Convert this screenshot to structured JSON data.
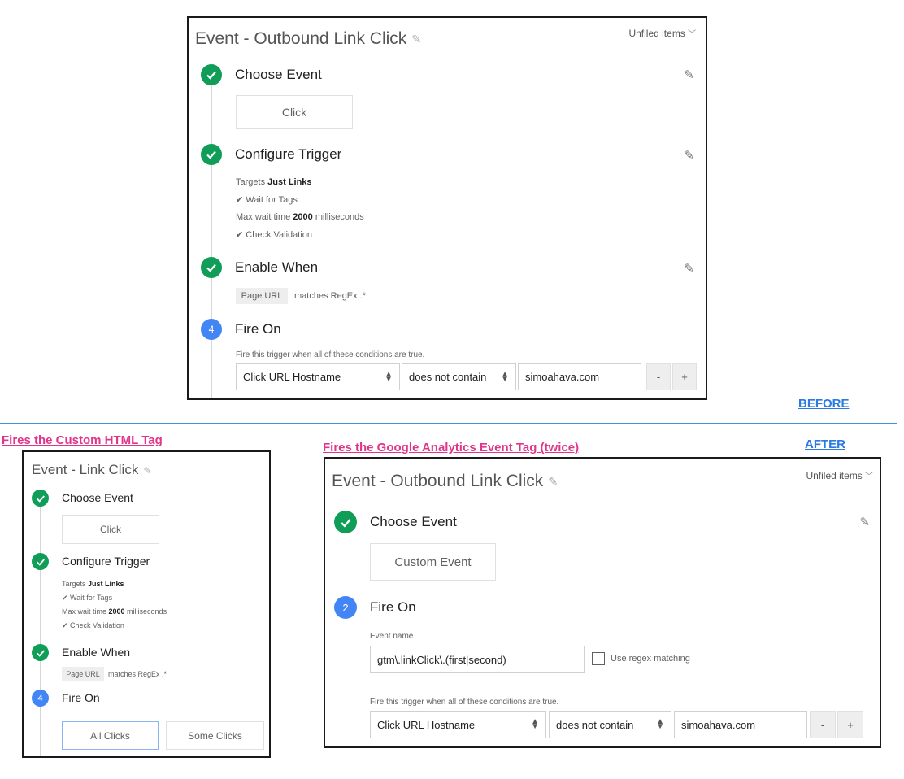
{
  "captions": {
    "before": "BEFORE",
    "after": "AFTER",
    "fires_custom_html": "Fires the  Custom HTML Tag",
    "fires_ga_event": "Fires the Google Analytics Event Tag (twice)"
  },
  "colors": {
    "accent_green": "#0f9d58",
    "accent_blue": "#4285f4",
    "caption_pink": "#e0358a",
    "caption_blue": "#2a7ae2"
  },
  "before": {
    "title": "Event - Outbound Link Click",
    "unfiled": "Unfiled items",
    "step1": {
      "title": "Choose Event",
      "chip": "Click"
    },
    "step2": {
      "title": "Configure Trigger",
      "targets_prefix": "Targets ",
      "targets_value": "Just Links",
      "wait_for_tags": "Wait for Tags",
      "max_wait_prefix": "Max wait time ",
      "max_wait_value": "2000",
      "max_wait_suffix": " milliseconds",
      "check_validation": "Check Validation"
    },
    "step3": {
      "title": "Enable When",
      "pill": "Page URL",
      "condition": "matches RegEx .*"
    },
    "step4": {
      "number": "4",
      "title": "Fire On",
      "hint": "Fire this trigger when all of these conditions are true.",
      "variable": "Click URL Hostname",
      "operator": "does not contain",
      "value": "simoahava.com",
      "minus": "-",
      "plus": "+"
    }
  },
  "after_left": {
    "title": "Event - Link Click",
    "step1": {
      "title": "Choose Event",
      "chip": "Click"
    },
    "step2": {
      "title": "Configure Trigger",
      "targets_prefix": "Targets ",
      "targets_value": "Just Links",
      "wait_for_tags": "Wait for Tags",
      "max_wait_prefix": "Max wait time ",
      "max_wait_value": "2000",
      "max_wait_suffix": " milliseconds",
      "check_validation": "Check Validation"
    },
    "step3": {
      "title": "Enable When",
      "pill": "Page URL",
      "condition": "matches RegEx .*"
    },
    "step4": {
      "number": "4",
      "title": "Fire On",
      "all_clicks": "All Clicks",
      "some_clicks": "Some Clicks"
    }
  },
  "after_right": {
    "title": "Event - Outbound Link Click",
    "unfiled": "Unfiled items",
    "step1": {
      "title": "Choose Event",
      "chip": "Custom Event"
    },
    "step2": {
      "number": "2",
      "title": "Fire On",
      "event_name_label": "Event name",
      "event_name_value": "gtm\\.linkClick\\.(first|second)",
      "regex_label": "Use regex matching",
      "hint": "Fire this trigger when all of these conditions are true.",
      "variable": "Click URL Hostname",
      "operator": "does not contain",
      "value": "simoahava.com",
      "minus": "-",
      "plus": "+"
    }
  }
}
